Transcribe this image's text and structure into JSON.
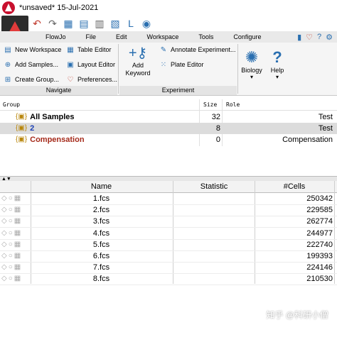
{
  "window": {
    "title": "*unsaved* 15-Jul-2021"
  },
  "ribbon_tabs": [
    "FlowJo",
    "File",
    "Edit",
    "Workspace",
    "Tools",
    "Configure"
  ],
  "navigate": {
    "label": "Navigate",
    "buttons": [
      "New Workspace",
      "Add Samples...",
      "Create Group..."
    ],
    "buttons2": [
      "Table Editor",
      "Layout Editor",
      "Preferences..."
    ]
  },
  "experiment": {
    "label": "Experiment",
    "add_keyword": "Add\nKeyword",
    "annotate": "Annotate Experiment...",
    "plate_editor": "Plate Editor"
  },
  "biology": {
    "label": "Biology"
  },
  "help": {
    "label": "Help"
  },
  "groups_table": {
    "headers": [
      "Group",
      "Size",
      "Role"
    ],
    "rows": [
      {
        "name": "All Samples",
        "size": "32",
        "role": "Test",
        "color": "#000000"
      },
      {
        "name": "2",
        "size": "8",
        "role": "Test",
        "color": "#1a3fb5"
      },
      {
        "name": "Compensation",
        "size": "0",
        "role": "Compensation",
        "color": "#a52a1a"
      }
    ]
  },
  "samples_table": {
    "headers": [
      "Name",
      "Statistic",
      "#Cells"
    ],
    "rows": [
      {
        "name": "1.fcs",
        "stat": "",
        "cells": "250342"
      },
      {
        "name": "2.fcs",
        "stat": "",
        "cells": "229585"
      },
      {
        "name": "3.fcs",
        "stat": "",
        "cells": "262774"
      },
      {
        "name": "4.fcs",
        "stat": "",
        "cells": "244977"
      },
      {
        "name": "5.fcs",
        "stat": "",
        "cells": "222740"
      },
      {
        "name": "6.fcs",
        "stat": "",
        "cells": "199393"
      },
      {
        "name": "7.fcs",
        "stat": "",
        "cells": "224146"
      },
      {
        "name": "8.fcs",
        "stat": "",
        "cells": "210530"
      }
    ]
  },
  "watermark": "知乎 @科研小僧"
}
